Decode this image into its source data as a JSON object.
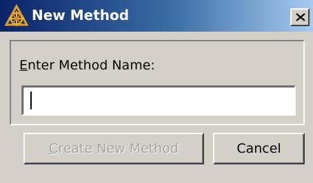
{
  "window": {
    "title": "New Method",
    "app_icon": "compass-wheel-icon",
    "close_icon": "close-icon"
  },
  "form": {
    "label_mnemonic": "E",
    "label_rest": "nter Method Name:",
    "method_name_value": ""
  },
  "buttons": {
    "create_mnemonic": "C",
    "create_rest": "reate New Method",
    "create_enabled": false,
    "cancel_label": "Cancel"
  },
  "colors": {
    "titlebar_start": "#0a246a",
    "titlebar_end": "#a6caf0",
    "face": "#d4d0c8",
    "disabled_text": "#a8a49c",
    "icon_accent": "#e8a020"
  }
}
